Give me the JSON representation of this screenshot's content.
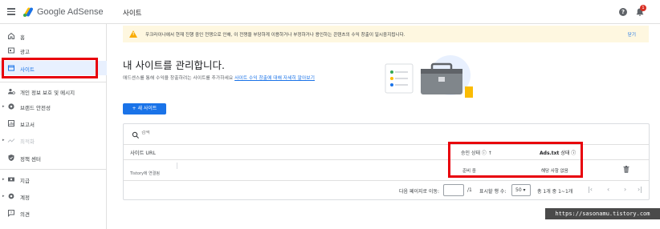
{
  "header": {
    "brand_name": "Google AdSense",
    "page_title": "사이트",
    "help_icon": "help-circle-icon",
    "notification_count": "1",
    "colors": {
      "brand_blue": "#1a73e8",
      "brand_yellow": "#fbbc04",
      "brand_green": "#34a853"
    }
  },
  "sidebar": {
    "items": [
      {
        "label": "홈",
        "icon": "home-icon"
      },
      {
        "label": "광고",
        "icon": "ads-icon"
      },
      {
        "label": "사이트",
        "icon": "sites-icon",
        "active": true
      },
      {
        "label": "개인 정보 보호 및 메시지",
        "icon": "privacy-messaging-icon"
      },
      {
        "label": "브랜드 안전성",
        "icon": "brand-safety-icon"
      },
      {
        "label": "보고서",
        "icon": "reports-icon"
      },
      {
        "label": "최적화",
        "icon": "optimization-icon",
        "disabled": true
      },
      {
        "label": "정책 센터",
        "icon": "policy-center-icon"
      },
      {
        "label": "지급",
        "icon": "payments-icon"
      },
      {
        "label": "계정",
        "icon": "account-gear-icon"
      },
      {
        "label": "의견",
        "icon": "feedback-icon"
      }
    ],
    "highlight_color": "#e8000b"
  },
  "banner": {
    "message": "우크라이나에서 현재 진행 중인 전쟁으로 인해, 이 전쟁을 부당하게 이용하거나 부정하거나 용인하는 콘텐츠의 수익 창출이 일시중지됩니다.",
    "dismiss_label": "닫기",
    "background_color": "#fef7e0"
  },
  "main": {
    "title": "내 사이트를 관리합니다.",
    "subtitle": "애드센스를 통해 수익을 창출하려는 사이트를 추가하세요",
    "subtitle_link": "사이트 수익 창출에 대해 자세히 알아보기",
    "new_site_button": "+ 새 사이트"
  },
  "table": {
    "search_placeholder": "검색",
    "columns": {
      "site_url": "사이트 URL",
      "approval_status": "승인 상태 ⓘ ↑",
      "ads_txt_status": "Ads.txt",
      "ads_txt_status_suffix": " 상태 ⓘ"
    },
    "rows": [
      {
        "site_url": "Tistory에 연결됨",
        "approval_status": "준비 중",
        "ads_txt_status": "해당 사항 없음"
      }
    ],
    "pagination": {
      "goto_label": "다음 페이지로 이동:",
      "page_total": "/1",
      "rows_per_page_label": "표시할 행 수:",
      "rows_per_page_value": "50 ▾",
      "range": "총 1개 중 1~1개"
    }
  },
  "watermark": "https://sasonamu.tistory.com"
}
